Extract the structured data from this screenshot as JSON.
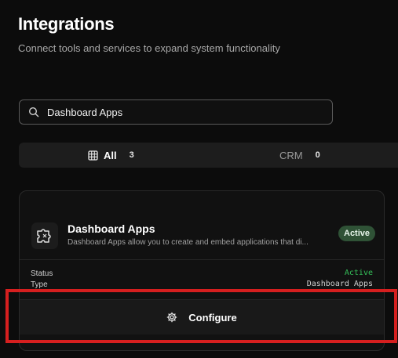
{
  "header": {
    "title": "Integrations",
    "subtitle": "Connect tools and services to expand system functionality"
  },
  "search": {
    "value": "Dashboard Apps",
    "icon": "search-icon"
  },
  "tabs": [
    {
      "label": "All",
      "count": "3",
      "icon": "grid-icon",
      "selected": true
    },
    {
      "label": "CRM",
      "count": "0",
      "selected": false
    }
  ],
  "card": {
    "title": "Dashboard Apps",
    "description": "Dashboard Apps allow you to create and embed applications that di...",
    "badge": "Active",
    "status_label": "Status",
    "status_value": "Active",
    "type_label": "Type",
    "type_value": "Dashboard Apps",
    "configure_label": "Configure",
    "logo_icon": "puzzle-icon",
    "configure_icon": "gear-icon"
  },
  "colors": {
    "background": "#0c0c0c",
    "badge_bg": "#2f5236",
    "status_active": "#35c15a",
    "highlight": "#d61f1f"
  }
}
